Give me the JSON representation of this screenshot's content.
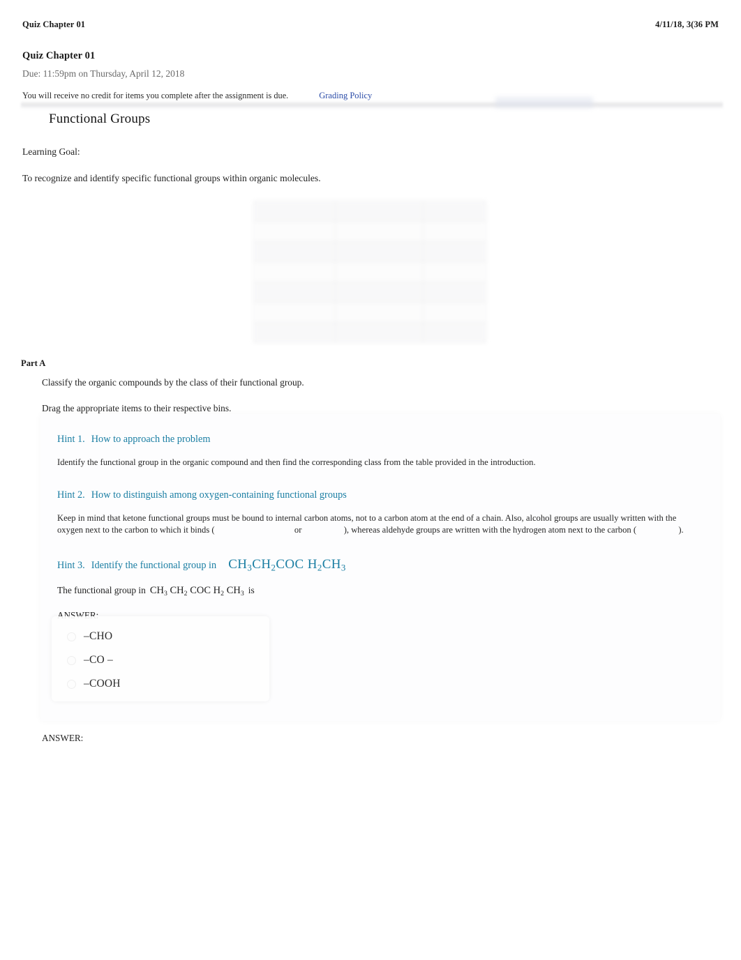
{
  "print_header": {
    "title": "Quiz Chapter 01",
    "date": "4/11/18, 3(36 PM"
  },
  "assignment": {
    "title": "Quiz Chapter 01",
    "due": "Due: 11:59pm on Thursday, April 12, 2018",
    "note": "You will receive no credit for items you complete after the assignment is due.",
    "grading_policy_link": "Grading Policy"
  },
  "problem": {
    "title": "Functional Groups",
    "learning_goal_label": "Learning Goal:",
    "learning_goal_text": "To recognize and identify specific functional groups within organic molecules."
  },
  "part": {
    "label": "Part A",
    "instruction_1": "Classify the organic compounds by the class of their functional group.",
    "instruction_2": "Drag the appropriate items to their respective bins."
  },
  "hints": [
    {
      "number": "Hint 1.",
      "title": "How to approach the problem",
      "body": "Identify the functional group in the organic compound and then find the corresponding class from the table provided in the introduction."
    },
    {
      "number": "Hint 2.",
      "title": "How to distinguish among oxygen-containing functional groups",
      "body_part_1": "Keep in mind that ketone functional groups must be bound to internal carbon atoms, not to a carbon atom at the end of a chain. Also, alcohol groups are usually written with the oxygen next to the carbon to which it binds (",
      "body_part_2": "or",
      "body_part_3": "), whereas aldehyde groups are written with the hydrogen atom next to the carbon (",
      "body_part_4": ")."
    },
    {
      "number": "Hint 3.",
      "title": "Identify the functional group in",
      "formula_html": "CH<sub>3</sub>CH<sub>2</sub>COC H<sub>2</sub>CH<sub>3</sub>",
      "question_prefix": "The functional group in",
      "question_formula_html": "CH<sub>3</sub> CH<sub>2</sub> COC H<sub>2</sub> CH<sub>3</sub>",
      "question_suffix": "is",
      "answer_label": "ANSWER:"
    }
  ],
  "options": [
    {
      "label": "–CHO",
      "selected": false
    },
    {
      "label": "–CO –",
      "selected": false
    },
    {
      "label": "–COOH",
      "selected": false
    }
  ],
  "final_answer_label": "ANSWER:",
  "colors": {
    "hint_teal": "#1a7ea3",
    "link_blue": "#2b4ca8",
    "due_gray": "#6a6a6a",
    "body_text": "#222222"
  },
  "faded_table": {
    "columns": 3,
    "rows": 7
  }
}
